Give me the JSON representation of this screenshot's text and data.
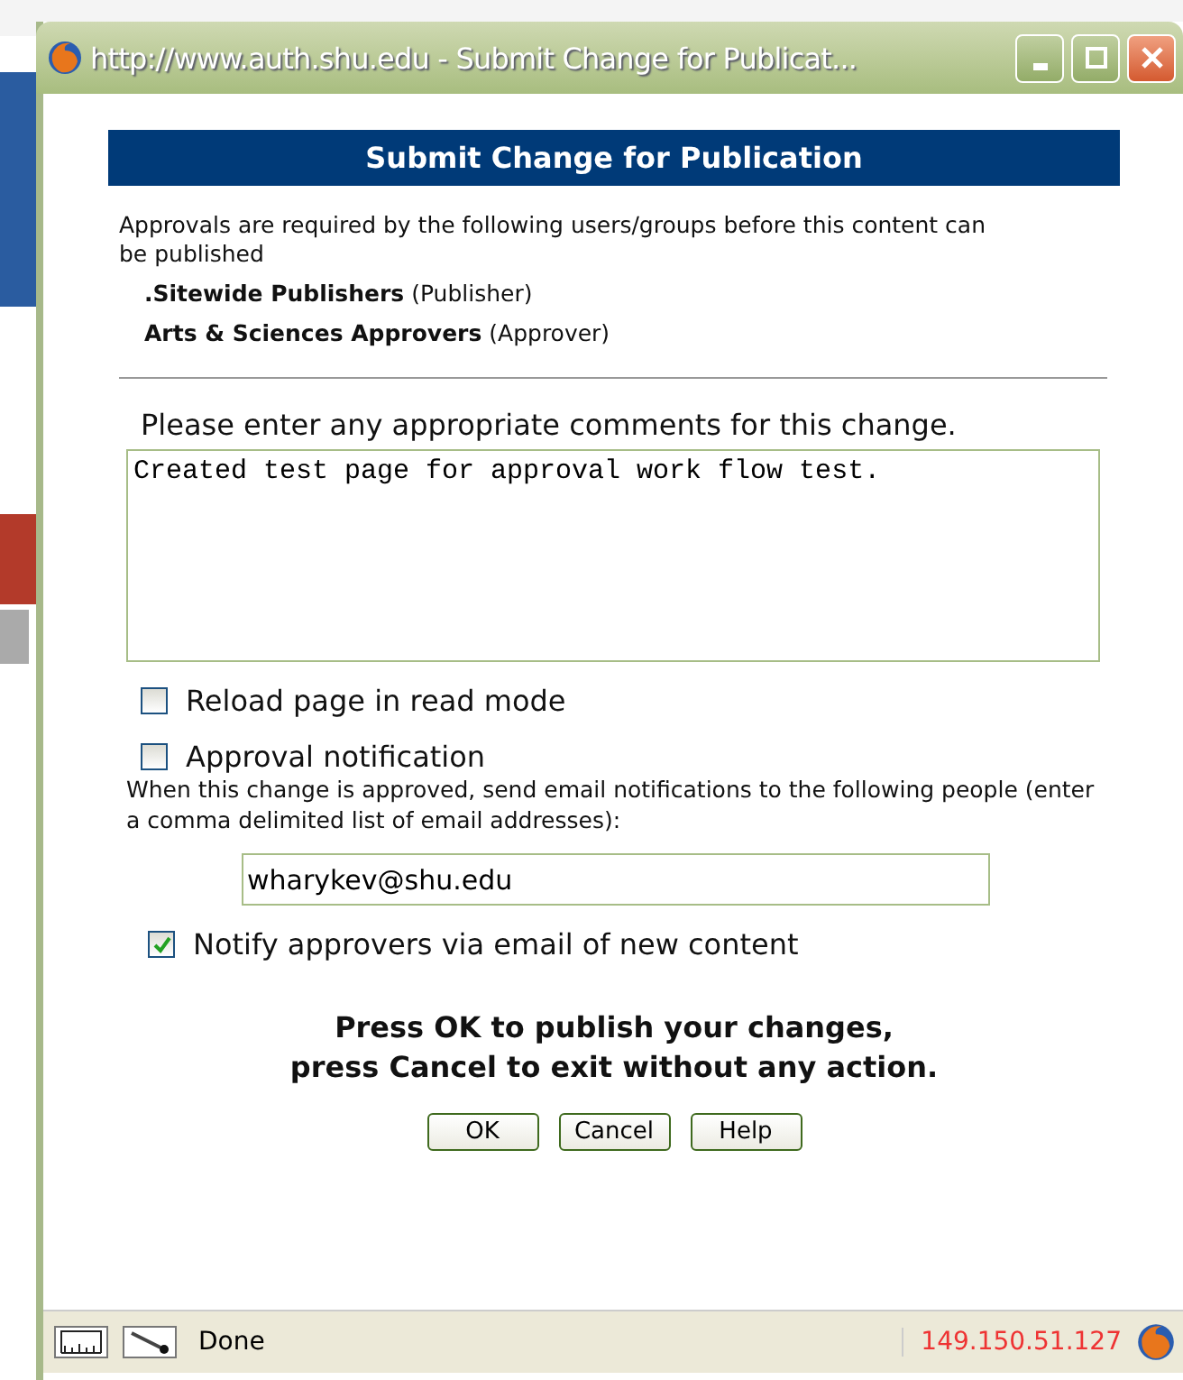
{
  "window": {
    "title": "http://www.auth.shu.edu - Submit Change for Publicat..."
  },
  "header": {
    "title": "Submit Change for Publication"
  },
  "approvals": {
    "intro": "Approvals are required by the following users/groups before this content can be published",
    "groups": [
      {
        "name": ".Sitewide Publishers",
        "role": "(Publisher)"
      },
      {
        "name": "Arts & Sciences Approvers",
        "role": "(Approver)"
      }
    ]
  },
  "comments": {
    "label": "Please enter any appropriate comments for this change.",
    "value": "Created test page for approval work flow test."
  },
  "items": [
    {
      "kind": "checkbox",
      "label": "Reload page in read mode",
      "checked": false
    },
    {
      "kind": "checkbox",
      "label": "Approval notification",
      "checked": false
    },
    {
      "kind": "note",
      "text": "When this change is approved, send email notifications to the following people (enter a comma delimited list of email addresses):"
    },
    {
      "kind": "field",
      "value": "wharykev@shu.edu"
    },
    {
      "kind": "checkbox",
      "label": "Notify approvers via email of new content",
      "checked": true
    }
  ],
  "message": [
    "Press OK to publish your changes,",
    "press Cancel to exit without any action."
  ],
  "buttons": [
    "OK",
    "Cancel",
    "Help"
  ],
  "status_bar": {
    "text": "Done",
    "address": "149.150.51.127"
  }
}
